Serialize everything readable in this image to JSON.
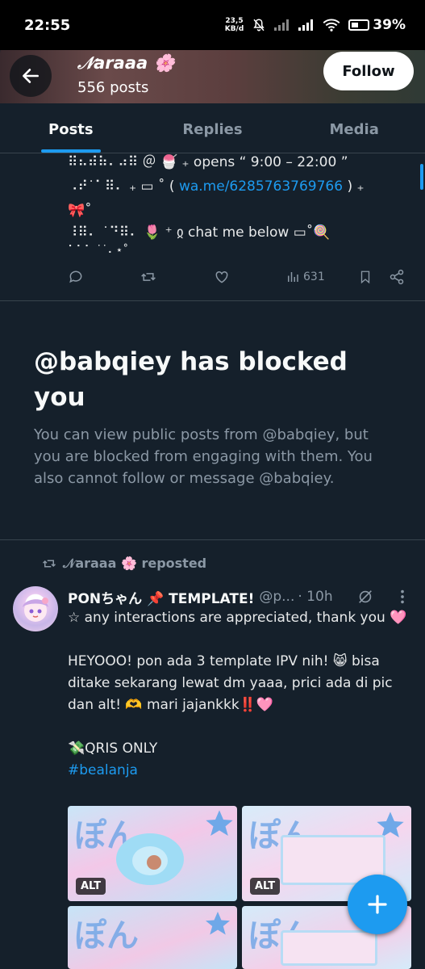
{
  "status_bar": {
    "time": "22:55",
    "net_speed_value": "23,5",
    "net_speed_unit": "KB/d",
    "battery": "39%"
  },
  "header": {
    "name": "𝒩araaa 🌸",
    "posts": "556 posts",
    "follow_label": "Follow"
  },
  "tabs": [
    "Posts",
    "Replies",
    "Media"
  ],
  "prev_tweet": {
    "line1": "⠿⠦⠾⠷⠄⠴⠿ ＠ 🍧 ₊ opens “ 9:00 – 22:00 ”",
    "line2_pre": "⠠⠞˙⠁⠿⠄ ₊ ▭ ˚ ( ",
    "line2_link": "wa.me/6285763769766",
    "line2_post": " ) ₊",
    "line3": "🎀˚",
    "line4": "⠸⠿⠄ ˙⠙⠿⠄ 🌷 ⁺ ჲ  chat me below ▭˚🍭",
    "line5": "⠁⠁⠁       ˙˙⠄⋆˚",
    "views": "631"
  },
  "blocked": {
    "title": "@babqiey has blocked you",
    "description": "You can view public posts from @babqiey, but you are blocked from engaging with them. You also cannot follow or message @babqiey."
  },
  "repost": {
    "label": "𝒩araaa 🌸 reposted",
    "author_name": "PONちゃん 📌 TEMPLATE!",
    "author_handle": "@p...",
    "time": "· 10h",
    "body_1": "☆ any interactions are appreciated, thank you 🩷",
    "body_2": "HEYOOO! pon ada 3 template IPV nih! 😸 bisa ditake sekarang lewat dm yaaa, prici ada di pic dan alt! 🫶 mari jajankkk‼️🩷",
    "body_3": "💸QRIS ONLY",
    "hashtag": "#bealanja",
    "alt_label": "ALT"
  },
  "colors": {
    "background": "#15202b",
    "accent": "#1d9bf0",
    "muted": "#8b98a5"
  }
}
